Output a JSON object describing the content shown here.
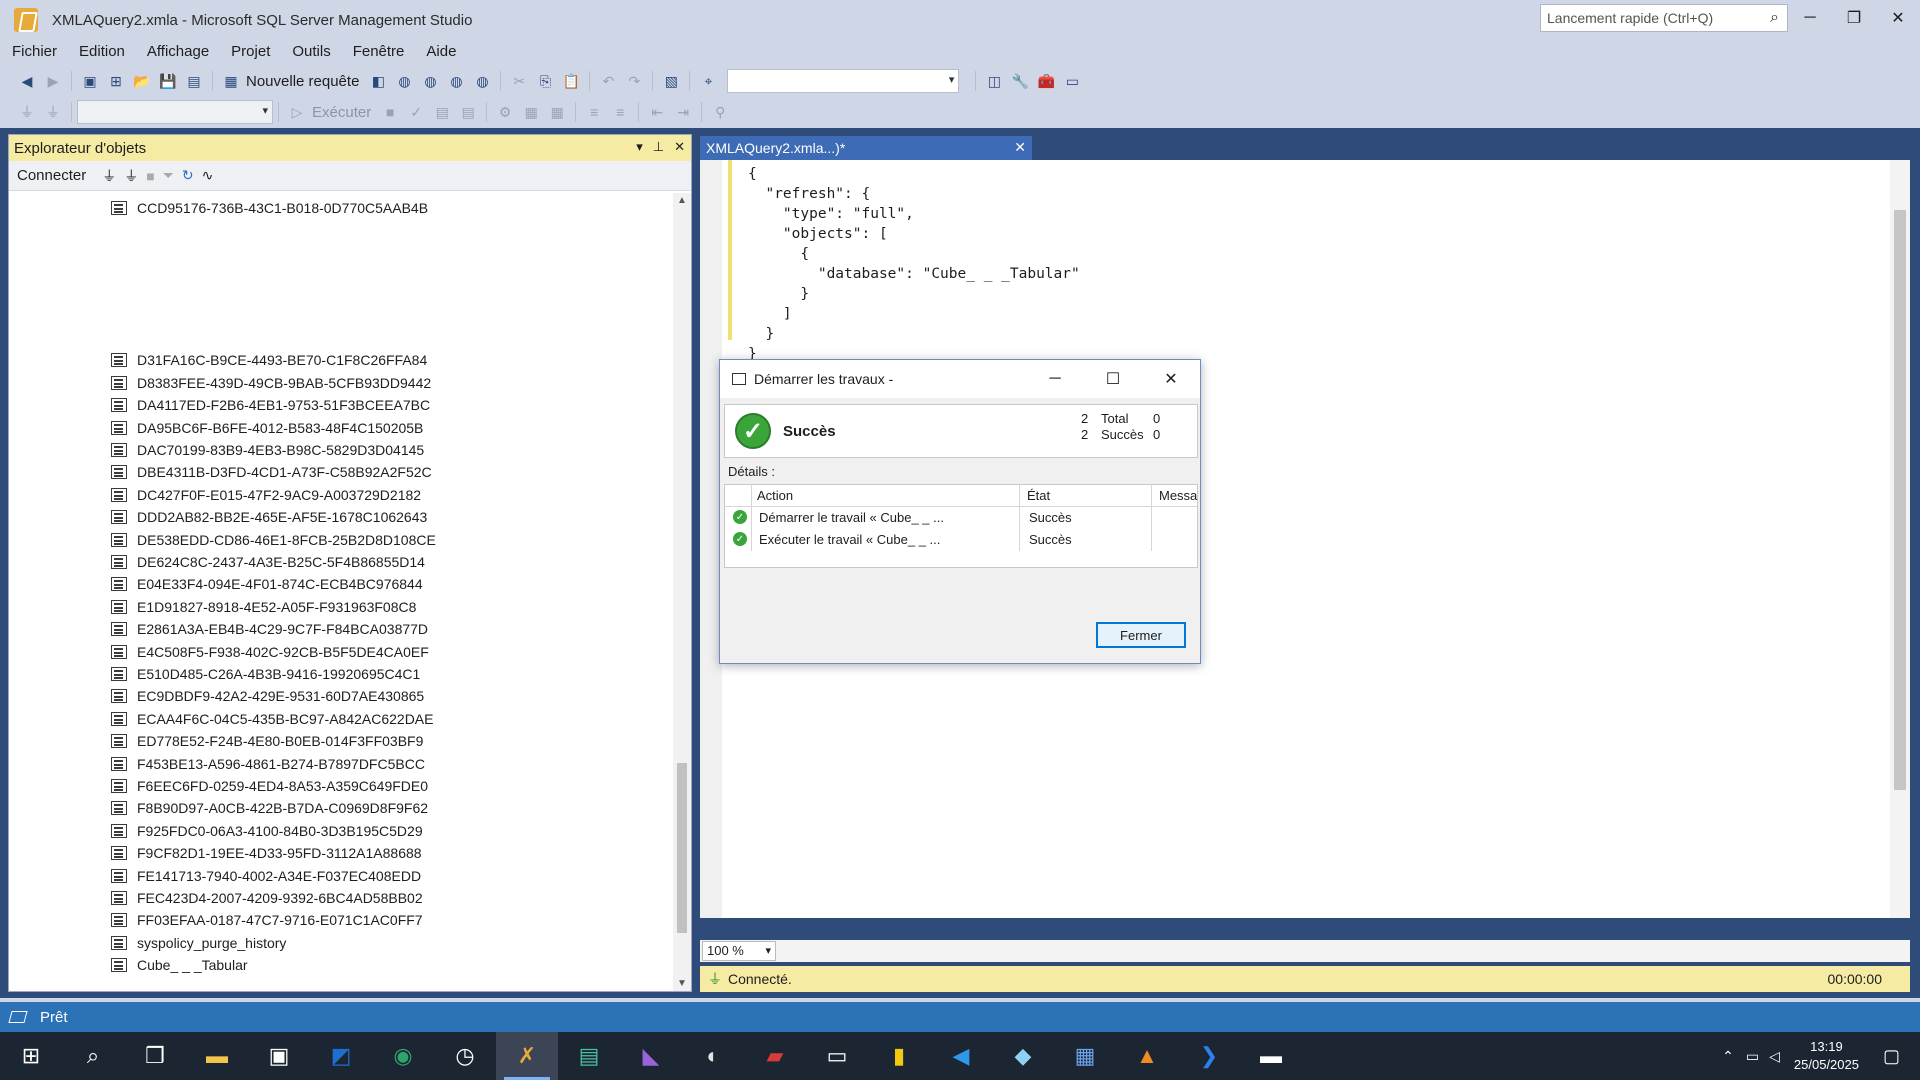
{
  "window": {
    "title": "XMLAQuery2.xmla - Microsoft SQL Server Management Studio",
    "quick_launch_placeholder": "Lancement rapide (Ctrl+Q)"
  },
  "menu": [
    "Fichier",
    "Edition",
    "Affichage",
    "Projet",
    "Outils",
    "Fenêtre",
    "Aide"
  ],
  "toolbar": {
    "new_query": "Nouvelle requête",
    "execute": "Exécuter"
  },
  "object_explorer": {
    "title": "Explorateur d'objets",
    "connect": "Connecter",
    "items": [
      "CCD95176-736B-43C1-B018-0D770C5AAB4B",
      "D31FA16C-B9CE-4493-BE70-C1F8C26FFA84",
      "D8383FEE-439D-49CB-9BAB-5CFB93DD9442",
      "DA4117ED-F2B6-4EB1-9753-51F3BCEEA7BC",
      "DA95BC6F-B6FE-4012-B583-48F4C150205B",
      "DAC70199-83B9-4EB3-B98C-5829D3D04145",
      "DBE4311B-D3FD-4CD1-A73F-C58B92A2F52C",
      "DC427F0F-E015-47F2-9AC9-A003729D2182",
      "DDD2AB82-BB2E-465E-AF5E-1678C1062643",
      "DE538EDD-CD86-46E1-8FCB-25B2D8D108CE",
      "DE624C8C-2437-4A3E-B25C-5F4B86855D14",
      "E04E33F4-094E-4F01-874C-ECB4BC976844",
      "E1D91827-8918-4E52-A05F-F931963F08C8",
      "E2861A3A-EB4B-4C29-9C7F-F84BCA03877D",
      "E4C508F5-F938-402C-92CB-B5F5DE4CA0EF",
      "E510D485-C26A-4B3B-9416-19920695C4C1",
      "EC9DBDF9-42A2-429E-9531-60D7AE430865",
      "ECAA4F6C-04C5-435B-BC97-A842AC622DAE",
      "ED778E52-F24B-4E80-B0EB-014F3FF03BF9",
      "F453BE13-A596-4861-B274-B7897DFC5BCC",
      "F6EEC6FD-0259-4ED4-8A53-A359C649FDE0",
      "F8B90D97-A0CB-422B-B7DA-C0969D8F9F62",
      "F925FDC0-06A3-4100-84B0-3D3B195C5D29",
      "F9CF82D1-19EE-4D33-95FD-3112A1A88688",
      "FE141713-7940-4002-A34E-F037EC408EDD",
      "FEC423D4-2007-4209-9392-6BC4AD58BB02",
      "FF03EFAA-0187-47C7-9716-E071C1AC0FF7",
      "syspolicy_purge_history",
      "Cube_ _ _Tabular"
    ]
  },
  "editor": {
    "tab_label": "XMLAQuery2.xmla...)*",
    "code": "{\n  \"refresh\": {\n    \"type\": \"full\",\n    \"objects\": [\n      {\n        \"database\": \"Cube_ _ _Tabular\"\n      }\n    ]\n  }\n}",
    "zoom": "100 %",
    "status": "Connecté.",
    "elapsed": "00:00:00"
  },
  "dialog": {
    "title": "Démarrer les travaux -",
    "result": "Succès",
    "counts": {
      "total_label": "Total",
      "total": "2",
      "success_label": "Succès",
      "success": "2",
      "c3": "0",
      "c4": "0"
    },
    "details_label": "Détails :",
    "columns": [
      "Action",
      "État",
      "Messa"
    ],
    "rows": [
      {
        "action": "Démarrer le travail « Cube_ _ ...",
        "state": "Succès"
      },
      {
        "action": "Exécuter le travail « Cube_ _ ...",
        "state": "Succès"
      }
    ],
    "close_button": "Fermer"
  },
  "app_status": "Prêt",
  "taskbar": {
    "time": "13:19",
    "date": "25/05/2025"
  }
}
